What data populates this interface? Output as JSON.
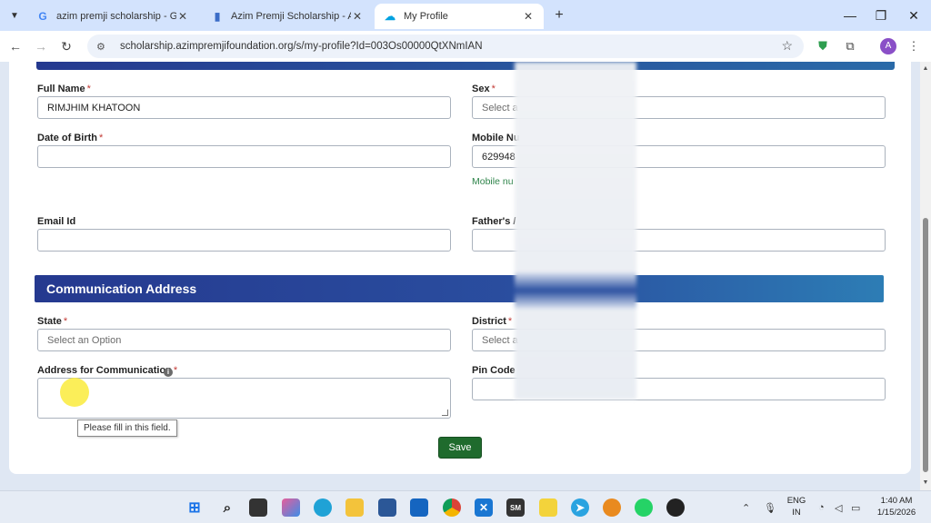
{
  "browser": {
    "tabs": [
      {
        "title": "azim premji scholarship - Goog",
        "icon": "G",
        "icon_color": "#4285f4"
      },
      {
        "title": "Azim Premji Scholarship - Azim",
        "icon": "▮",
        "icon_color": "#3a6cc7"
      },
      {
        "title": "My Profile",
        "icon": "☁",
        "icon_color": "#00a1e0"
      }
    ],
    "url": "scholarship.azimpremjifoundation.org/s/my-profile?Id=003Os00000QtXNmIAN",
    "avatar_letter": "A"
  },
  "form": {
    "full_name_label": "Full Name",
    "full_name_value": "RIMJHIM KHATOON",
    "sex_label": "Sex",
    "sex_placeholder": "Select a",
    "dob_label": "Date of Birth",
    "dob_value": "",
    "mobile_label": "Mobile Nu",
    "mobile_value": "629948",
    "mobile_hint": "Mobile nu",
    "email_label": "Email Id",
    "email_value": "",
    "father_label": "Father's /",
    "father_value": "",
    "required_mark": "*"
  },
  "address": {
    "section_title": "Communication Address",
    "state_label": "State",
    "state_placeholder": "Select an Option",
    "district_label": "District",
    "district_placeholder": "Select a",
    "comm_label": "Address for Communication",
    "pin_label": "Pin Code",
    "tooltip": "Please fill in this field.",
    "save_label": "Save"
  },
  "taskbar": {
    "lang_line1": "ENG",
    "lang_line2": "IN",
    "time": "1:40 AM",
    "date": "1/15/2026"
  }
}
